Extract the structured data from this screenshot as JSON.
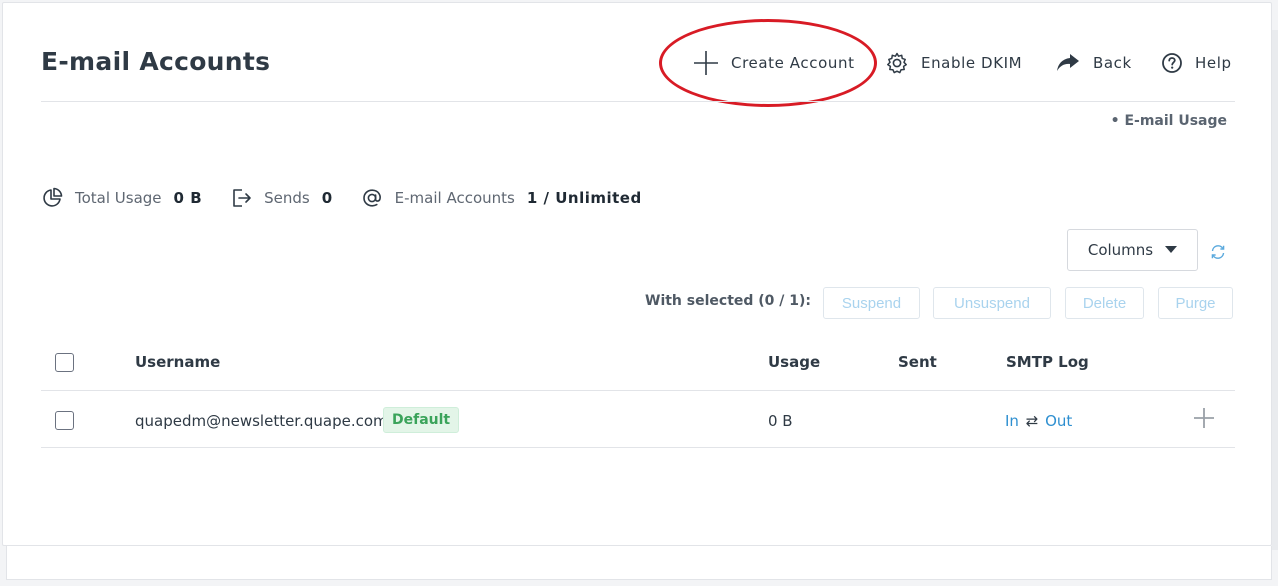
{
  "page": {
    "title": "E-mail Accounts"
  },
  "header": {
    "actions": [
      {
        "label": "Create Account",
        "icon": "plus-icon"
      },
      {
        "label": "Enable DKIM",
        "icon": "gear-icon"
      },
      {
        "label": "Back",
        "icon": "back-arrow-icon"
      },
      {
        "label": "Help",
        "icon": "help-icon"
      }
    ],
    "usage_link": "• E-mail Usage"
  },
  "stats": {
    "total_usage_label": "Total Usage",
    "total_usage_value": "0 B",
    "sends_label": "Sends",
    "sends_value": "0",
    "accounts_label": "E-mail Accounts",
    "accounts_value": "1 / Unlimited"
  },
  "toolbar": {
    "columns_label": "Columns",
    "with_selected": "With selected (0 / 1):",
    "suspend": "Suspend",
    "unsuspend": "Unsuspend",
    "delete": "Delete",
    "purge": "Purge"
  },
  "table": {
    "headers": [
      "Username",
      "Usage",
      "Sent",
      "SMTP Log"
    ],
    "rows": [
      {
        "username": "quapedm@newsletter.quape.com",
        "badge": "Default",
        "usage": "0 B",
        "sent": "",
        "smtp_in": "In",
        "smtp_arrows": "⇄",
        "smtp_out": "Out"
      }
    ]
  },
  "colors": {
    "accent_link": "#2e8fd0",
    "annotation_red": "#d81b25",
    "badge_green": "#3aa35a"
  }
}
